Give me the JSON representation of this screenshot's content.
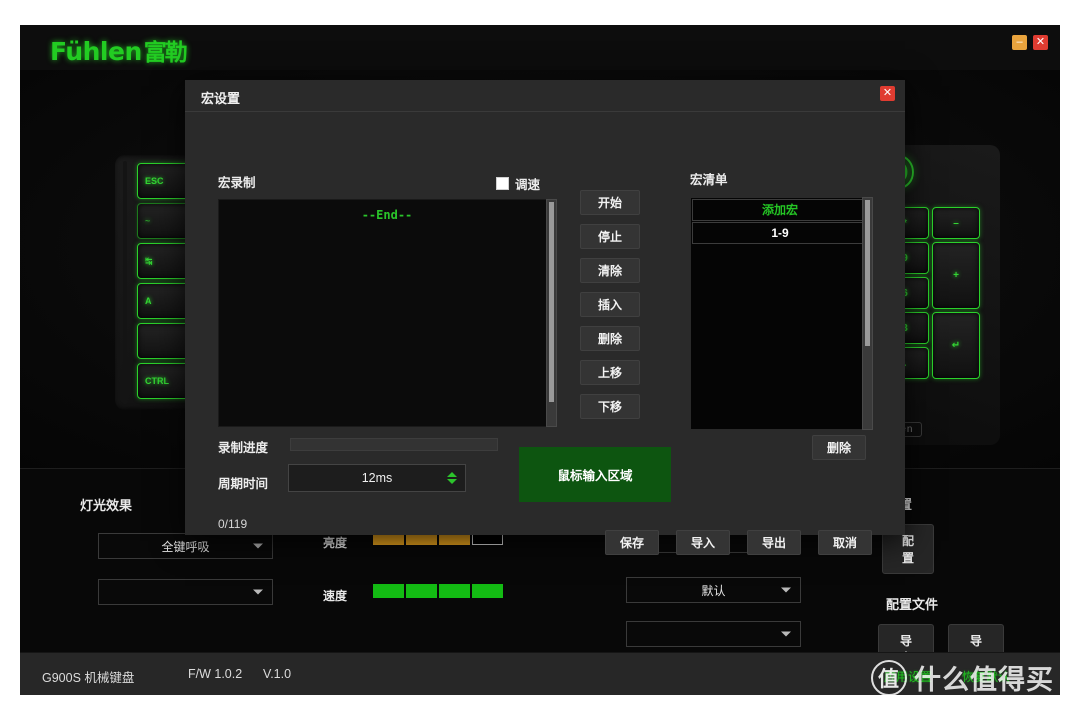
{
  "app": {
    "brand_latin": "Fühlen",
    "brand_cn": "富勒",
    "minimize_label": "–",
    "close_label": "✕"
  },
  "keyboard": {
    "left_keys": [
      "ESC",
      "~",
      "↹",
      "A",
      "",
      "CTRL"
    ],
    "numpad_rows": [
      [
        "*",
        "–"
      ],
      [
        "9",
        "+"
      ],
      [
        "6",
        ""
      ],
      [
        "3",
        "↵"
      ],
      [
        ".",
        ""
      ]
    ],
    "brand_plate": "ühlen"
  },
  "lighting": {
    "title": "灯光效果",
    "effect_value": "全键呼吸",
    "effect_value_2": "",
    "brightness_label": "亮度",
    "brightness_segments": [
      "on",
      "on",
      "on",
      "off"
    ],
    "speed_label": "速度",
    "speed_segments": [
      "on",
      "on",
      "on",
      "on"
    ]
  },
  "center_panel": {
    "check_mark": "✓",
    "mode_value": "默认",
    "extra_value": ""
  },
  "right_panel": {
    "title": "设置",
    "config_button": "配置",
    "profile_title": "配置文件",
    "export_button": "导出",
    "import_button": "导入"
  },
  "statusbar": {
    "device": "G900S 机械键盘",
    "firmware": "F/W 1.0.2",
    "version": "V.1.0",
    "apply_link": "应用设置",
    "restore_link": "恢复默认",
    "watermark_mark": "值",
    "watermark_text": "什么值得买"
  },
  "dialog": {
    "title": "宏设置",
    "close_label": "✕",
    "record_label": "宏录制",
    "speed_checkbox_label": "调速",
    "record_end_marker": "--End--",
    "action_buttons": [
      "开始",
      "停止",
      "清除",
      "插入",
      "删除",
      "上移",
      "下移"
    ],
    "macro_list_label": "宏清单",
    "macro_list_items": [
      {
        "label": "添加宏",
        "kind": "add"
      },
      {
        "label": "1-9",
        "kind": "sel"
      }
    ],
    "delete_button": "删除",
    "progress_label": "录制进度",
    "cycle_label": "周期时间",
    "cycle_value": "12ms",
    "mouse_zone_label": "鼠标输入区域",
    "counter": "0/119",
    "footer_buttons": [
      "保存",
      "导入",
      "导出",
      "取消"
    ]
  }
}
